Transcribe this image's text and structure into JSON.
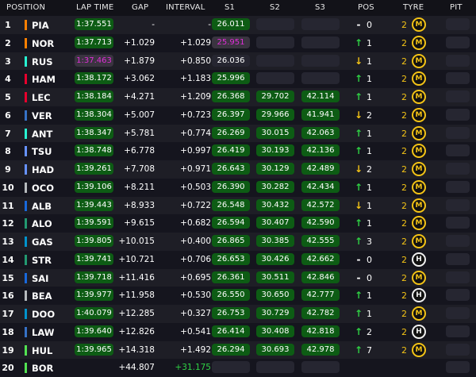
{
  "columns": {
    "position": "POSITION",
    "lap_time": "LAP TIME",
    "gap": "GAP",
    "interval": "INTERVAL",
    "s1": "S1",
    "s2": "S2",
    "s3": "S3",
    "pos": "POS",
    "tyre": "TYRE",
    "pit": "PIT"
  },
  "tyre_letters": {
    "medium": "M",
    "hard": "H"
  },
  "colors": {
    "sector_green": "#0d5c14",
    "fastest_purple": "#e02ed8",
    "tyre_medium": "#f3c316",
    "tyre_hard": "#f0f0f0"
  },
  "rows": [
    {
      "position": "1",
      "driver": "PIA",
      "team_color": "#ff8000",
      "lap_time": "1:37.551",
      "lap_style": "green",
      "gap": "-",
      "interval": "-",
      "s1": "26.011",
      "s1_style": "green",
      "s2": "",
      "s3": "",
      "pos_dir": "neutral",
      "pos_icon": "-",
      "pos_change": "0",
      "tyre_laps": "2",
      "tyre": "medium"
    },
    {
      "position": "2",
      "driver": "NOR",
      "team_color": "#ff8000",
      "lap_time": "1:37.713",
      "lap_style": "green",
      "gap": "+1.029",
      "interval": "+1.029",
      "s1": "25.951",
      "s1_style": "purple",
      "s2": "",
      "s3": "",
      "pos_dir": "up",
      "pos_icon": "↑",
      "pos_change": "1",
      "tyre_laps": "2",
      "tyre": "medium"
    },
    {
      "position": "3",
      "driver": "RUS",
      "team_color": "#27f4d2",
      "lap_time": "1:37.463",
      "lap_style": "purple",
      "gap": "+1.879",
      "interval": "+0.850",
      "s1": "26.036",
      "s1_style": "grey",
      "s2": "",
      "s3": "",
      "pos_dir": "down",
      "pos_icon": "↓",
      "pos_change": "1",
      "tyre_laps": "2",
      "tyre": "medium"
    },
    {
      "position": "4",
      "driver": "HAM",
      "team_color": "#e8002d",
      "lap_time": "1:38.172",
      "lap_style": "green",
      "gap": "+3.062",
      "interval": "+1.183",
      "s1": "25.996",
      "s1_style": "green",
      "s2": "",
      "s3": "",
      "pos_dir": "up",
      "pos_icon": "↑",
      "pos_change": "1",
      "tyre_laps": "2",
      "tyre": "medium"
    },
    {
      "position": "5",
      "driver": "LEC",
      "team_color": "#e8002d",
      "lap_time": "1:38.184",
      "lap_style": "green",
      "gap": "+4.271",
      "interval": "+1.209",
      "s1": "26.368",
      "s1_style": "green",
      "s2": "29.702",
      "s3": "42.114",
      "pos_dir": "up",
      "pos_icon": "↑",
      "pos_change": "1",
      "tyre_laps": "2",
      "tyre": "medium"
    },
    {
      "position": "6",
      "driver": "VER",
      "team_color": "#3671c6",
      "lap_time": "1:38.304",
      "lap_style": "green",
      "gap": "+5.007",
      "interval": "+0.723",
      "s1": "26.397",
      "s1_style": "green",
      "s2": "29.966",
      "s3": "41.941",
      "pos_dir": "down",
      "pos_icon": "↓",
      "pos_change": "2",
      "tyre_laps": "2",
      "tyre": "medium"
    },
    {
      "position": "7",
      "driver": "ANT",
      "team_color": "#27f4d2",
      "lap_time": "1:38.347",
      "lap_style": "green",
      "gap": "+5.781",
      "interval": "+0.774",
      "s1": "26.269",
      "s1_style": "green",
      "s2": "30.015",
      "s3": "42.063",
      "pos_dir": "up",
      "pos_icon": "↑",
      "pos_change": "1",
      "tyre_laps": "2",
      "tyre": "medium"
    },
    {
      "position": "8",
      "driver": "TSU",
      "team_color": "#6692ff",
      "lap_time": "1:38.748",
      "lap_style": "green",
      "gap": "+6.778",
      "interval": "+0.997",
      "s1": "26.419",
      "s1_style": "green",
      "s2": "30.193",
      "s3": "42.136",
      "pos_dir": "up",
      "pos_icon": "↑",
      "pos_change": "1",
      "tyre_laps": "2",
      "tyre": "medium"
    },
    {
      "position": "9",
      "driver": "HAD",
      "team_color": "#6692ff",
      "lap_time": "1:39.261",
      "lap_style": "green",
      "gap": "+7.708",
      "interval": "+0.971",
      "s1": "26.643",
      "s1_style": "green",
      "s2": "30.129",
      "s3": "42.489",
      "pos_dir": "down",
      "pos_icon": "↓",
      "pos_change": "2",
      "tyre_laps": "2",
      "tyre": "medium"
    },
    {
      "position": "10",
      "driver": "OCO",
      "team_color": "#b6babd",
      "lap_time": "1:39.106",
      "lap_style": "green",
      "gap": "+8.211",
      "interval": "+0.503",
      "s1": "26.390",
      "s1_style": "green",
      "s2": "30.282",
      "s3": "42.434",
      "pos_dir": "up",
      "pos_icon": "↑",
      "pos_change": "1",
      "tyre_laps": "2",
      "tyre": "medium"
    },
    {
      "position": "11",
      "driver": "ALB",
      "team_color": "#1868db",
      "lap_time": "1:39.443",
      "lap_style": "green",
      "gap": "+8.933",
      "interval": "+0.722",
      "s1": "26.548",
      "s1_style": "green",
      "s2": "30.432",
      "s3": "42.572",
      "pos_dir": "down",
      "pos_icon": "↓",
      "pos_change": "1",
      "tyre_laps": "2",
      "tyre": "medium"
    },
    {
      "position": "12",
      "driver": "ALO",
      "team_color": "#229971",
      "lap_time": "1:39.591",
      "lap_style": "green",
      "gap": "+9.615",
      "interval": "+0.682",
      "s1": "26.594",
      "s1_style": "green",
      "s2": "30.407",
      "s3": "42.590",
      "pos_dir": "up",
      "pos_icon": "↑",
      "pos_change": "1",
      "tyre_laps": "2",
      "tyre": "medium"
    },
    {
      "position": "13",
      "driver": "GAS",
      "team_color": "#0093cc",
      "lap_time": "1:39.805",
      "lap_style": "green",
      "gap": "+10.015",
      "interval": "+0.400",
      "s1": "26.865",
      "s1_style": "green",
      "s2": "30.385",
      "s3": "42.555",
      "pos_dir": "up",
      "pos_icon": "↑",
      "pos_change": "3",
      "tyre_laps": "2",
      "tyre": "medium"
    },
    {
      "position": "14",
      "driver": "STR",
      "team_color": "#229971",
      "lap_time": "1:39.741",
      "lap_style": "green",
      "gap": "+10.721",
      "interval": "+0.706",
      "s1": "26.653",
      "s1_style": "green",
      "s2": "30.426",
      "s3": "42.662",
      "pos_dir": "neutral",
      "pos_icon": "-",
      "pos_change": "0",
      "tyre_laps": "2",
      "tyre": "hard"
    },
    {
      "position": "15",
      "driver": "SAI",
      "team_color": "#1868db",
      "lap_time": "1:39.718",
      "lap_style": "green",
      "gap": "+11.416",
      "interval": "+0.695",
      "s1": "26.361",
      "s1_style": "green",
      "s2": "30.511",
      "s3": "42.846",
      "pos_dir": "neutral",
      "pos_icon": "-",
      "pos_change": "0",
      "tyre_laps": "2",
      "tyre": "medium"
    },
    {
      "position": "16",
      "driver": "BEA",
      "team_color": "#b6babd",
      "lap_time": "1:39.977",
      "lap_style": "green",
      "gap": "+11.958",
      "interval": "+0.530",
      "s1": "26.550",
      "s1_style": "green",
      "s2": "30.650",
      "s3": "42.777",
      "pos_dir": "up",
      "pos_icon": "↑",
      "pos_change": "1",
      "tyre_laps": "2",
      "tyre": "hard"
    },
    {
      "position": "17",
      "driver": "DOO",
      "team_color": "#0093cc",
      "lap_time": "1:40.079",
      "lap_style": "green",
      "gap": "+12.285",
      "interval": "+0.327",
      "s1": "26.753",
      "s1_style": "green",
      "s2": "30.729",
      "s3": "42.782",
      "pos_dir": "up",
      "pos_icon": "↑",
      "pos_change": "1",
      "tyre_laps": "2",
      "tyre": "medium"
    },
    {
      "position": "18",
      "driver": "LAW",
      "team_color": "#3671c6",
      "lap_time": "1:39.640",
      "lap_style": "green",
      "gap": "+12.826",
      "interval": "+0.541",
      "s1": "26.414",
      "s1_style": "green",
      "s2": "30.408",
      "s3": "42.818",
      "pos_dir": "up",
      "pos_icon": "↑",
      "pos_change": "2",
      "tyre_laps": "2",
      "tyre": "hard"
    },
    {
      "position": "19",
      "driver": "HUL",
      "team_color": "#52e252",
      "lap_time": "1:39.965",
      "lap_style": "green",
      "gap": "+14.318",
      "interval": "+1.492",
      "s1": "26.294",
      "s1_style": "green",
      "s2": "30.693",
      "s3": "42.978",
      "pos_dir": "up",
      "pos_icon": "↑",
      "pos_change": "7",
      "tyre_laps": "2",
      "tyre": "medium"
    },
    {
      "position": "20",
      "driver": "BOR",
      "team_color": "#52e252",
      "lap_time": "",
      "lap_style": "grey",
      "gap": "+44.807",
      "interval": "+31.175",
      "s1": "",
      "s1_style": "grey",
      "s2": "",
      "s3": "",
      "pos_dir": "none",
      "pos_icon": "",
      "pos_change": "",
      "tyre_laps": "",
      "tyre": "none"
    }
  ]
}
